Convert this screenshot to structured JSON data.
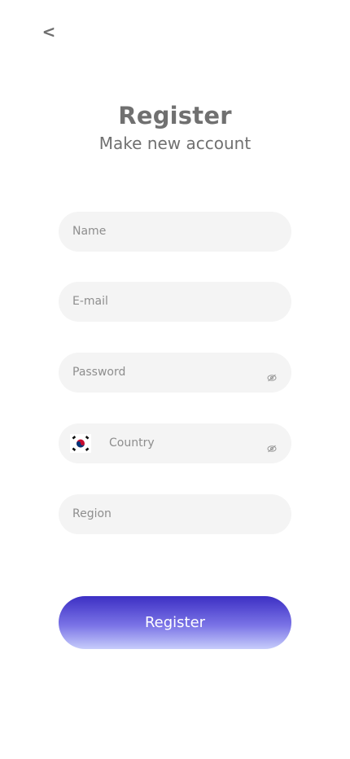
{
  "nav": {
    "back_label": "<"
  },
  "header": {
    "title": "Register",
    "subtitle": "Make new account"
  },
  "form": {
    "name_placeholder": "Name",
    "email_placeholder": "E-mail",
    "password_placeholder": "Password",
    "country_placeholder": "Country",
    "region_placeholder": "Region"
  },
  "icons": {
    "back": "chevron-left-icon",
    "password_visibility": "eye-off-icon",
    "country_visibility": "eye-off-icon",
    "country_flag": "south-korea-flag-icon"
  },
  "actions": {
    "register_label": "Register"
  },
  "colors": {
    "accent_top": "#3c2fc4",
    "accent_bottom": "#c7cdfb",
    "field_background": "#f4f4f4",
    "text_muted": "#8e8e8e"
  }
}
